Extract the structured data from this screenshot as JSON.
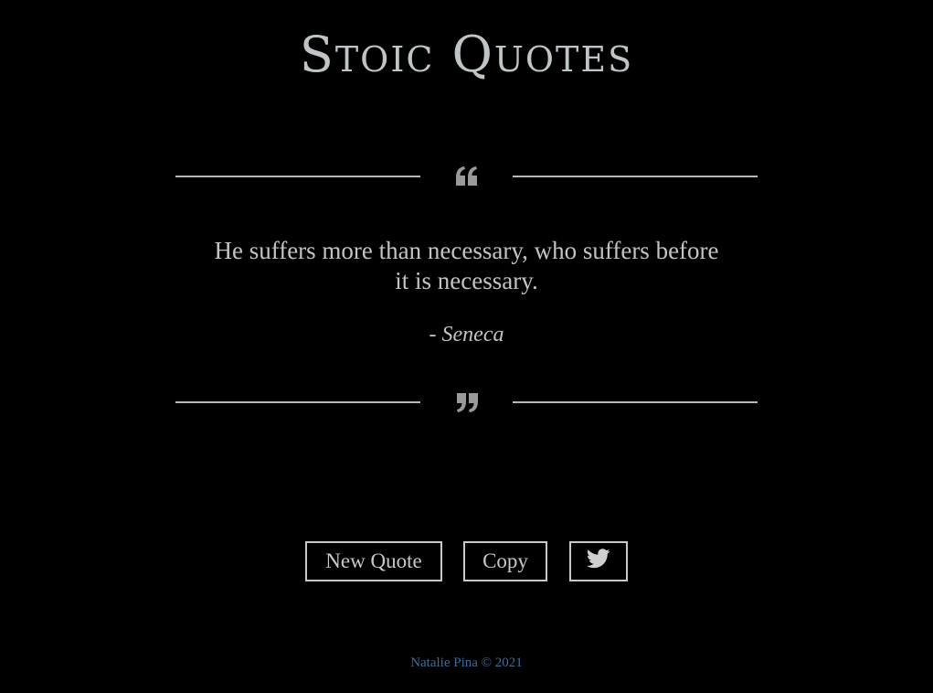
{
  "header": {
    "title": "Stoic Quotes"
  },
  "quote": {
    "open_mark_icon": "quote-left-icon",
    "close_mark_icon": "quote-right-icon",
    "text": "He suffers more than necessary, who suffers before it is necessary.",
    "author_prefix": "- ",
    "author": "Seneca"
  },
  "actions": {
    "new_quote_label": "New Quote",
    "copy_label": "Copy",
    "tweet_icon": "twitter-icon"
  },
  "footer": {
    "credit": "Natalie Pina © 2021"
  },
  "colors": {
    "background": "#000000",
    "title": "#bfc4c6",
    "text": "#c3c3c3",
    "footer": "#3f6d96"
  }
}
